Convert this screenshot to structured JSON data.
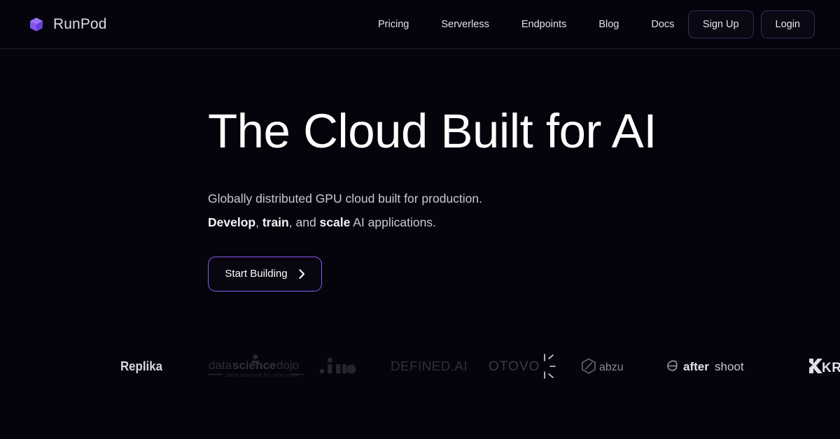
{
  "brand": {
    "name": "RunPod",
    "logo_icon": "cube-icon",
    "accent_color": "#8b5cf6"
  },
  "header": {
    "nav_items": [
      {
        "label": "Pricing"
      },
      {
        "label": "Serverless"
      },
      {
        "label": "Endpoints"
      },
      {
        "label": "Blog"
      },
      {
        "label": "Docs"
      }
    ],
    "sign_up_label": "Sign Up",
    "login_label": "Login"
  },
  "hero": {
    "title": "The Cloud Built for AI",
    "subtitle_line1": "Globally distributed GPU cloud built for production.",
    "subtitle_line2": {
      "bold1": "Develop",
      "sep1": ", ",
      "bold2": "train",
      "sep2": ", and ",
      "bold3": "scale",
      "tail": " AI applications."
    },
    "cta_label": "Start Building",
    "cta_icon": "chevron-right-icon"
  },
  "logos": [
    {
      "name": "Replika"
    },
    {
      "name": "datasciencedojo",
      "word1": "data",
      "word2": "science",
      "word3": "dojo",
      "tagline": "data science for everyone"
    },
    {
      "name": "jina"
    },
    {
      "name": "DEFINED.AI"
    },
    {
      "name": "OTOVO"
    },
    {
      "name": "abzu"
    },
    {
      "name": "aftershoot",
      "word1": "after",
      "word2": "shoot"
    },
    {
      "name": "KRN"
    }
  ],
  "colors": {
    "background": "#04040c",
    "accent": "#8b5cf6",
    "text_primary": "#ffffff",
    "text_secondary": "#c9c9d4",
    "border": "#1a1a2b"
  }
}
